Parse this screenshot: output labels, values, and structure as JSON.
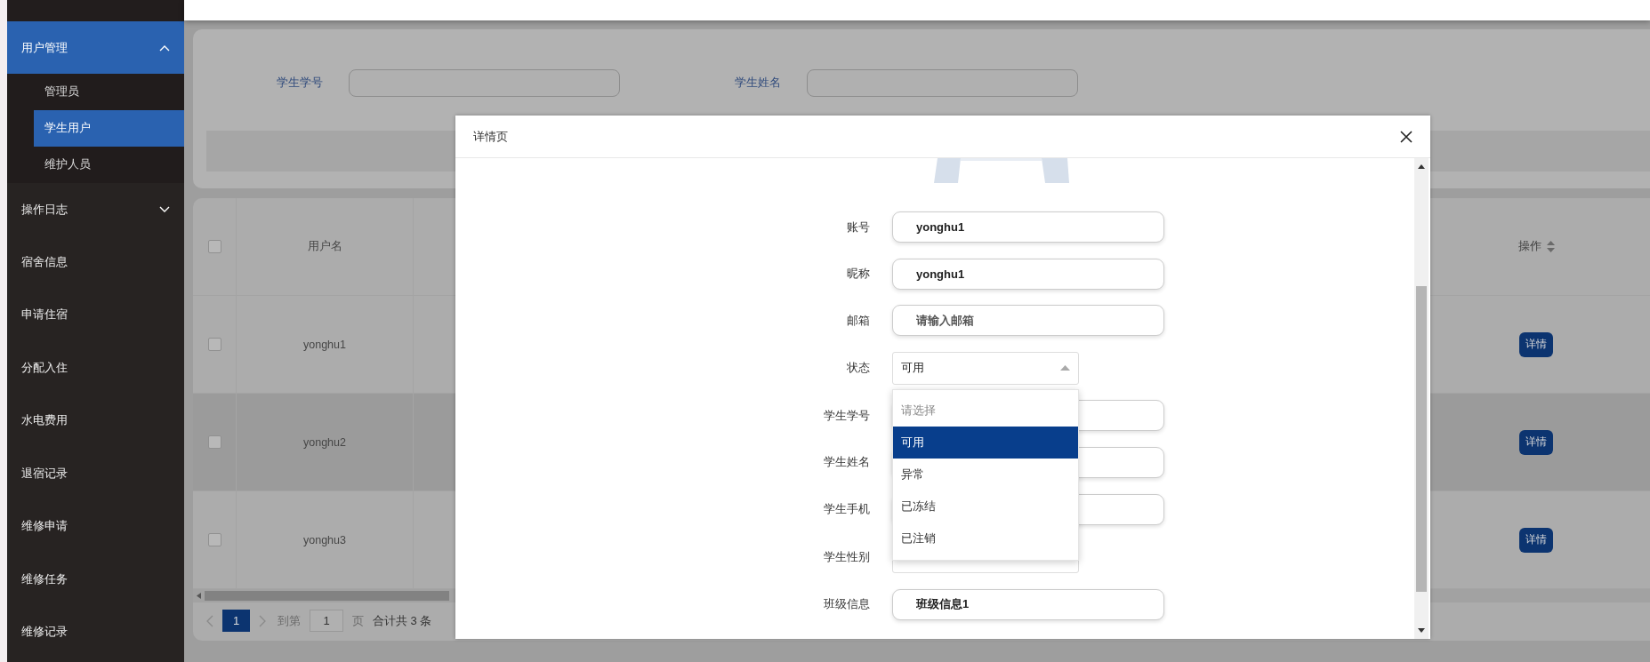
{
  "sidebar": {
    "items": [
      {
        "label": "用户管理",
        "kind": "group",
        "expanded": true,
        "active": true,
        "children": [
          {
            "label": "管理员",
            "selected": false
          },
          {
            "label": "学生用户",
            "selected": true
          },
          {
            "label": "维护人员",
            "selected": false
          }
        ]
      },
      {
        "label": "操作日志",
        "kind": "group",
        "expanded": false,
        "active": false
      },
      {
        "label": "宿舍信息",
        "kind": "link",
        "selected": false
      },
      {
        "label": "申请住宿",
        "kind": "link",
        "selected": false
      },
      {
        "label": "分配入住",
        "kind": "link",
        "selected": false
      },
      {
        "label": "水电费用",
        "kind": "link",
        "selected": false
      },
      {
        "label": "退宿记录",
        "kind": "link",
        "selected": false
      },
      {
        "label": "维修申请",
        "kind": "link",
        "selected": false
      },
      {
        "label": "维修任务",
        "kind": "link",
        "selected": false
      },
      {
        "label": "维修记录",
        "kind": "link",
        "selected": false
      }
    ]
  },
  "search": {
    "fields": [
      {
        "label": "学生学号"
      },
      {
        "label": "学生姓名"
      }
    ]
  },
  "table": {
    "header_checkbox": {
      "checked": false
    },
    "columns": [
      {
        "label": "用户名"
      },
      {
        "label": "操作"
      }
    ],
    "rows": [
      {
        "checked": false,
        "highlighted": false,
        "username": "yonghu1",
        "action": "详情"
      },
      {
        "checked": false,
        "highlighted": true,
        "username": "yonghu2",
        "action": "详情"
      },
      {
        "checked": false,
        "highlighted": false,
        "username": "yonghu3",
        "action": "详情"
      }
    ]
  },
  "pagination": {
    "current": "1",
    "goto_label": "到第",
    "goto_value": "1",
    "page_label": "页",
    "total": "合计共 3 条"
  },
  "dialog": {
    "title": "详情页",
    "fields": [
      {
        "label": "账号",
        "kind": "input",
        "value": "yonghu1"
      },
      {
        "label": "昵称",
        "kind": "input",
        "value": "yonghu1"
      },
      {
        "label": "邮箱",
        "kind": "input",
        "placeholder": "请输入邮箱"
      },
      {
        "label": "状态",
        "kind": "select",
        "value": "可用",
        "open": true
      },
      {
        "label": "学生学号",
        "kind": "input"
      },
      {
        "label": "学生姓名",
        "kind": "input"
      },
      {
        "label": "学生手机",
        "kind": "input"
      },
      {
        "label": "学生性别",
        "kind": "select"
      },
      {
        "label": "班级信息",
        "kind": "input",
        "value": "班级信息1"
      }
    ],
    "dropdown": {
      "placeholder": "请选择",
      "options": [
        {
          "label": "可用",
          "selected": true
        },
        {
          "label": "异常",
          "selected": false
        },
        {
          "label": "已冻结",
          "selected": false
        },
        {
          "label": "已注销",
          "selected": false
        }
      ]
    }
  }
}
